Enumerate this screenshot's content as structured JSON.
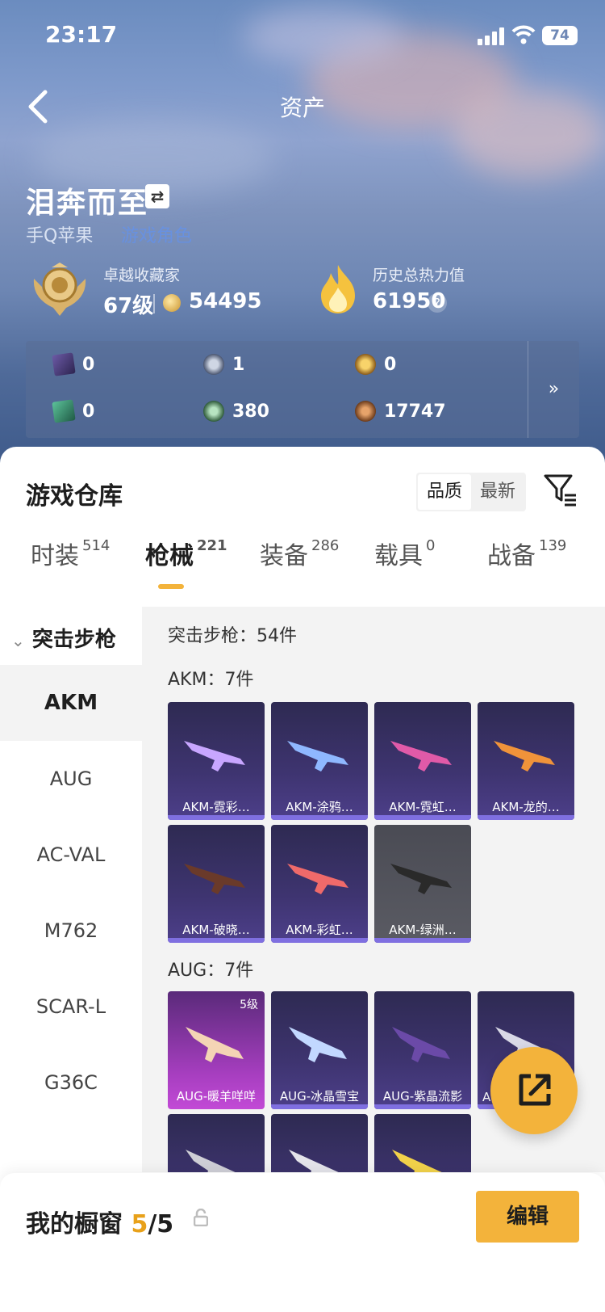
{
  "status": {
    "time": "23:17",
    "battery": "74"
  },
  "header": {
    "title": "资产"
  },
  "profile": {
    "name": "泪奔而至",
    "swap_icon": "⇄",
    "platform": "手Q苹果",
    "platform_link": "游戏角色"
  },
  "rank": {
    "label": "卓越收藏家",
    "level": "67级",
    "coins": "54495"
  },
  "heat": {
    "label": "历史总热力值",
    "value": "61950",
    "help": "?"
  },
  "currencies": [
    {
      "icon": "card-purple-icon",
      "value": "0"
    },
    {
      "icon": "silver-coin-icon",
      "value": "1"
    },
    {
      "icon": "gold-coin-icon",
      "value": "0"
    },
    {
      "icon": "card-green-icon",
      "value": "0"
    },
    {
      "icon": "green-gem-icon",
      "value": "380"
    },
    {
      "icon": "bronze-coin-icon",
      "value": "17747"
    }
  ],
  "currency_more": "»",
  "warehouse": {
    "title": "游戏仓库",
    "sort": [
      "品质",
      "最新"
    ],
    "tabs": [
      {
        "label": "时装",
        "count": "514"
      },
      {
        "label": "枪械",
        "count": "221"
      },
      {
        "label": "装备",
        "count": "286"
      },
      {
        "label": "载具",
        "count": "0"
      },
      {
        "label": "战备",
        "count": "139"
      }
    ]
  },
  "nav": {
    "head": "突击步枪",
    "items": [
      "AKM",
      "AUG",
      "AC-VAL",
      "M762",
      "SCAR-L",
      "G36C"
    ]
  },
  "content": {
    "category_summary": "突击步枪：54件",
    "akm_header": "AKM：7件",
    "aug_header": "AUG：7件",
    "akm_cards": [
      "AKM-霓彩…",
      "AKM-涂鸦…",
      "AKM-霓虹…",
      "AKM-龙的…",
      "AKM-破晓…",
      "AKM-彩虹…",
      "AKM-绿洲…"
    ],
    "aug_cards": [
      "AUG-暖羊咩咩",
      "AUG-冰晶雪宝",
      "AUG-紫晶流影",
      "A"
    ],
    "aug_level": "5级"
  },
  "bottom": {
    "showcase_label": "我的橱窗",
    "showcase_current": "5",
    "showcase_total": "/5",
    "edit": "编辑"
  },
  "colors": {
    "accent": "#f3b33b",
    "card_purple": "#3e3470",
    "card_bar": "#7f6fe0"
  }
}
